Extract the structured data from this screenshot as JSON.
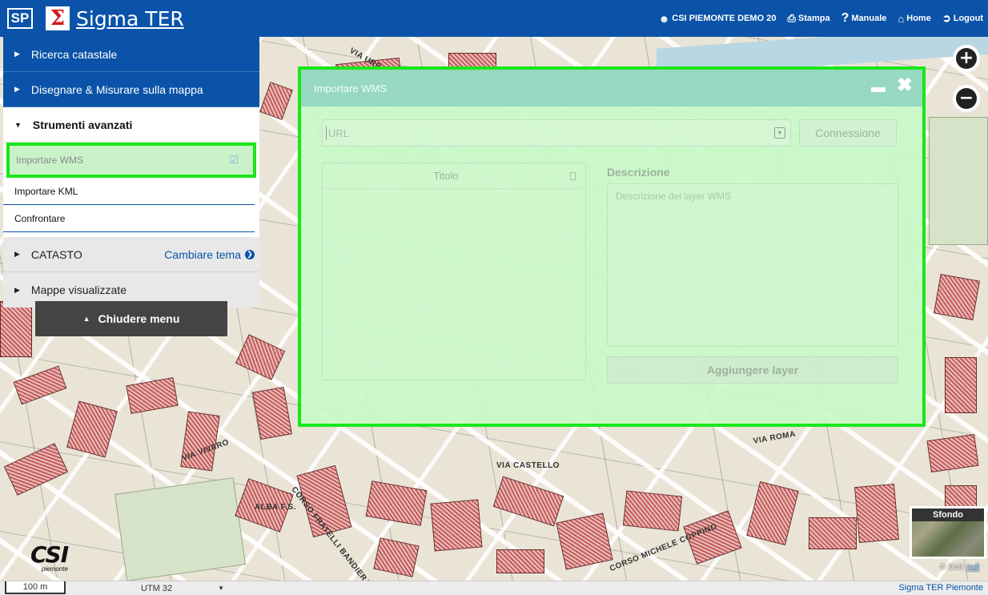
{
  "header": {
    "logo_sp": "SP",
    "logo_sigma": "Σ",
    "title": "Sigma TER",
    "user": "CSI PIEMONTE DEMO 20",
    "print": "Stampa",
    "manual": "Manuale",
    "home": "Home",
    "logout": "Logout",
    "accent": "#0a53a8"
  },
  "sidebar": {
    "items": [
      {
        "label": "Ricerca catastale"
      },
      {
        "label": "Disegnare & Misurare sulla mappa"
      },
      {
        "label": "Strumenti avanzati"
      },
      {
        "label": "CATASTO",
        "action": "Cambiare tema"
      },
      {
        "label": "Mappe visualizzate"
      }
    ],
    "subitems": [
      {
        "label": "Importare WMS"
      },
      {
        "label": "Importare KML"
      },
      {
        "label": "Confrontare"
      }
    ],
    "close_menu": "Chiudere menu"
  },
  "dialog": {
    "title": "Importare WMS",
    "url_placeholder": "URL",
    "connect_label": "Connessione",
    "table_header": "Titolo",
    "description_label": "Descrizione",
    "description_placeholder": "Descrizione dei layer WMS",
    "add_label": "Aggiungere layer"
  },
  "map": {
    "labels": [
      "CORSO FRATELLI BANDIERA",
      "ALBA F.S.",
      "CORSO MICHELE COPPINO",
      "VIA VIVARO",
      "VIA ROMA",
      "VIA CASTELLO",
      "VIA URBANO"
    ],
    "background_label": "Sfondo",
    "attribution": "© Dati: ",
    "attribution_link": "null",
    "logo": "CSI",
    "logo_sub": "piemonte"
  },
  "footer": {
    "scale": "100 m",
    "projection": "UTM 32",
    "brand": "Sigma TER Piemonte"
  }
}
